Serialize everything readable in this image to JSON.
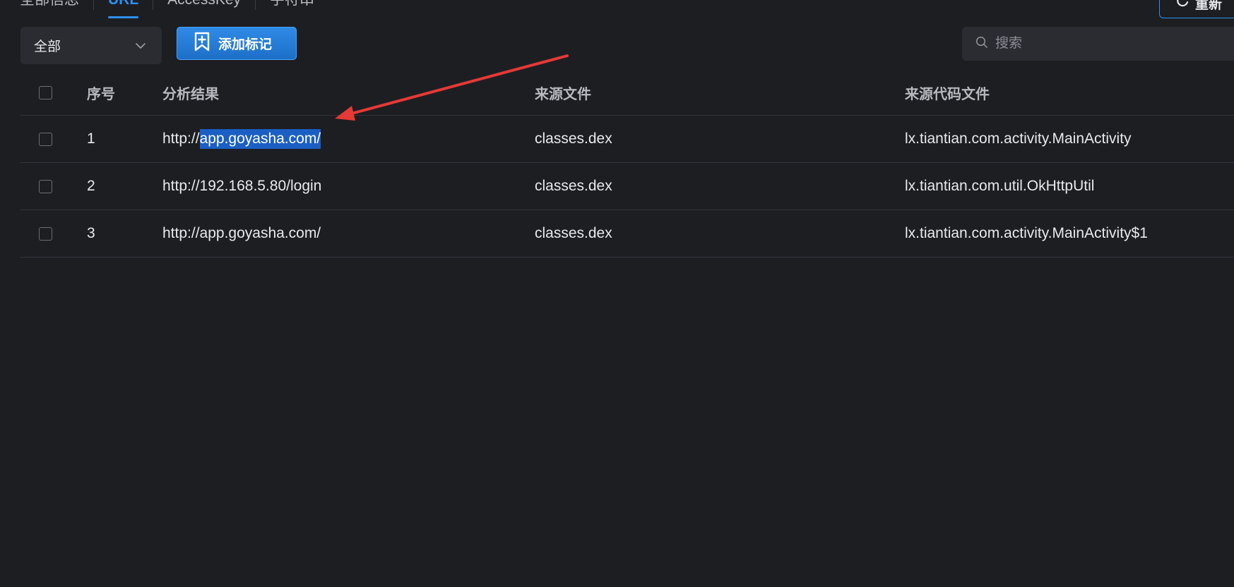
{
  "tabs": [
    {
      "label": "全部信息",
      "active": false
    },
    {
      "label": "URL",
      "active": true
    },
    {
      "label": "AccessKey",
      "active": false
    },
    {
      "label": "字符串",
      "active": false
    }
  ],
  "toolbar": {
    "refresh_label": "重新",
    "filter_value": "全部",
    "add_mark_label": "添加标记",
    "search_placeholder": "搜索"
  },
  "table": {
    "columns": {
      "index": "序号",
      "result": "分析结果",
      "source_file": "来源文件",
      "source_code_file": "来源代码文件"
    },
    "rows": [
      {
        "index": "1",
        "result_prefix": "http://",
        "result_selected": "app.goyasha.com/",
        "source_file": "classes.dex",
        "source_code_file": "lx.tiantian.com.activity.MainActivity"
      },
      {
        "index": "2",
        "result": "http://192.168.5.80/login",
        "source_file": "classes.dex",
        "source_code_file": "lx.tiantian.com.util.OkHttpUtil"
      },
      {
        "index": "3",
        "result": "http://app.goyasha.com/",
        "source_file": "classes.dex",
        "source_code_file": "lx.tiantian.com.activity.MainActivity$1"
      }
    ]
  },
  "colors": {
    "background": "#1d1e22",
    "accent": "#2e8ff0",
    "selection": "#1b5fc4",
    "annotation_arrow": "#e53935"
  },
  "icons": {
    "refresh": "refresh-icon",
    "dropdown": "chevron-down-icon",
    "add_mark": "bookmark-plus-icon",
    "search": "search-icon"
  }
}
